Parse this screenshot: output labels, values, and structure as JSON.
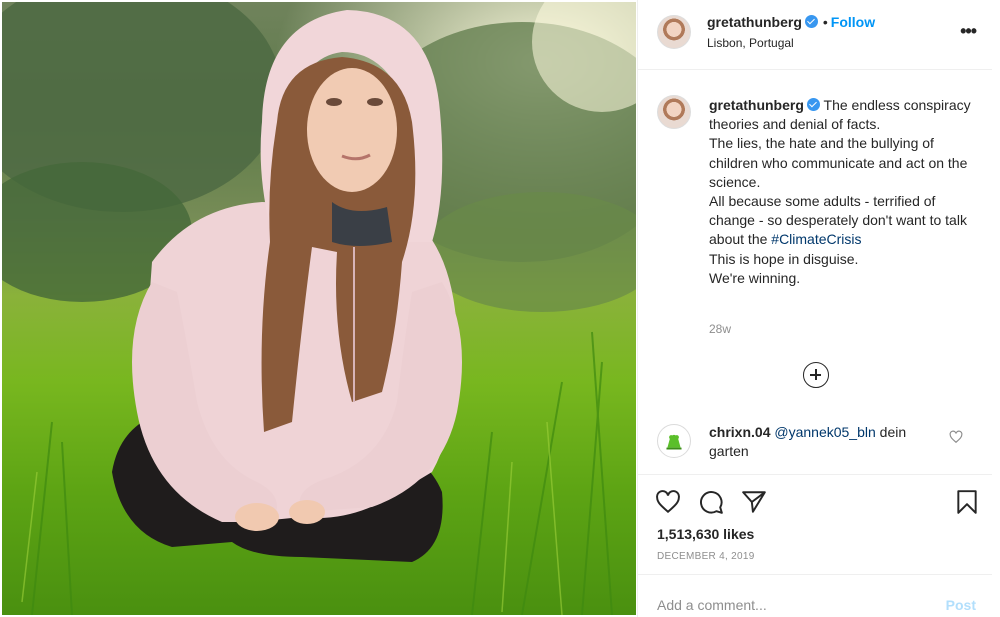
{
  "post": {
    "username": "gretathunberg",
    "follow_label": "Follow",
    "dot": "•",
    "location": "Lisbon, Portugal",
    "more_label": "•••",
    "caption": {
      "line1": "The endless conspiracy theories and denial of facts.",
      "line2": "The lies, the hate and the bullying of children who communicate and act on the science.",
      "line3_prefix": "All because some adults - terrified of change - so desperately don't want to talk about the",
      "hashtag": "#ClimateCrisis",
      "line4": "This is hope in disguise.",
      "line5": "We're winning."
    },
    "time_ago": "28w",
    "likes": "1,513,630 likes",
    "date": "DECEMBER 4, 2019"
  },
  "comments": [
    {
      "username": "chrixn.04",
      "mention": "@yannek05_bln",
      "text": "dein garten"
    }
  ],
  "composer": {
    "placeholder": "Add a comment...",
    "post_label": "Post"
  },
  "icons": {
    "verified": "verified-badge-icon",
    "more": "more-options-icon",
    "load_more": "plus-circle-icon",
    "comment_like": "heart-icon",
    "like": "heart-icon",
    "comment": "comment-bubble-icon",
    "share": "paper-plane-icon",
    "save": "bookmark-icon"
  },
  "colors": {
    "accent": "#0095f6",
    "link": "#00376b",
    "verified": "#3897f0",
    "muted": "#8e8e8e",
    "post_disabled": "#b2dffc"
  }
}
